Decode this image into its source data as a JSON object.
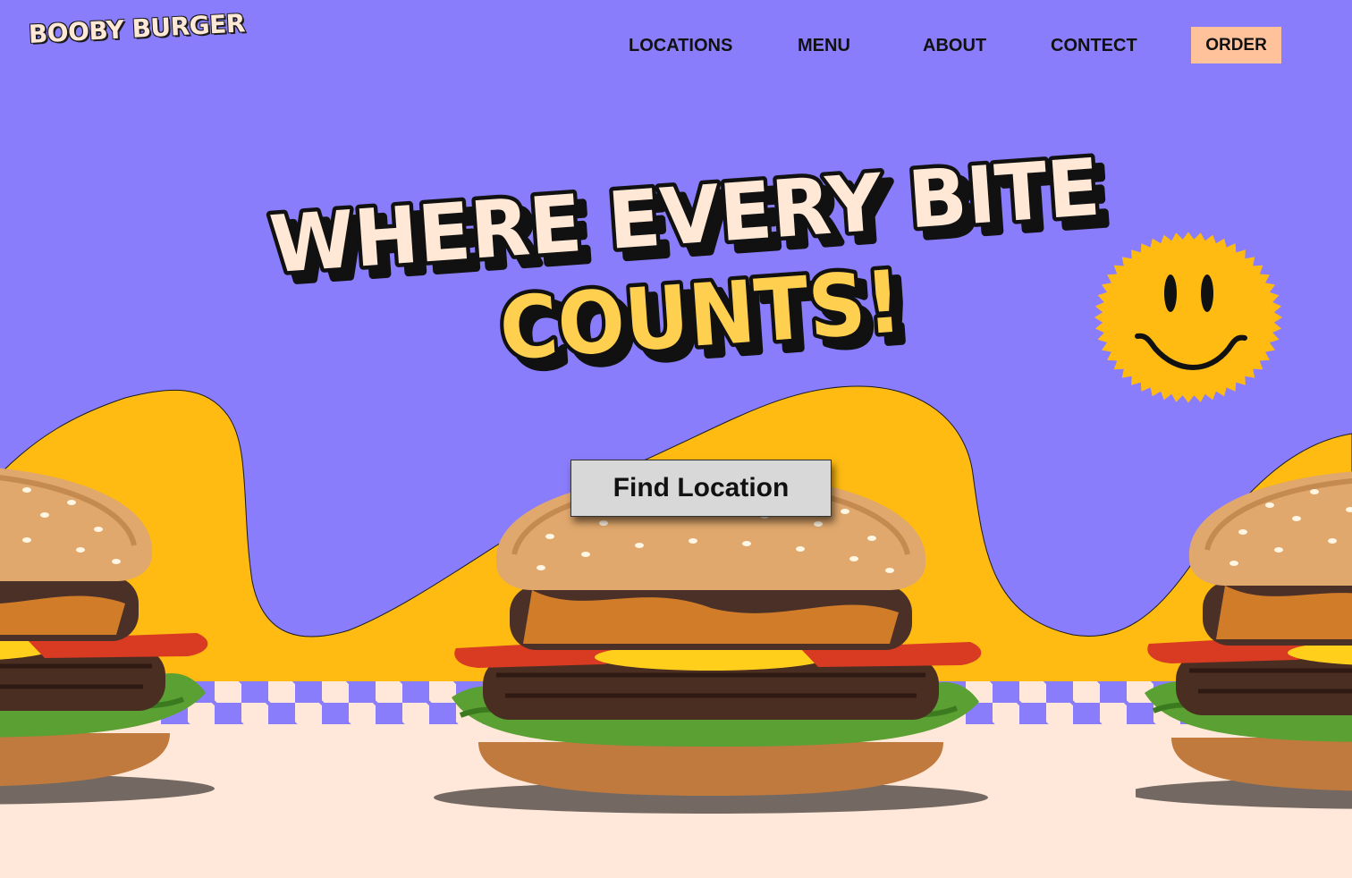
{
  "brand": {
    "logo": "BOOBY BURGER"
  },
  "nav": {
    "items": [
      "LOCATIONS",
      "MENU",
      "ABOUT",
      "CONTECT"
    ],
    "order_label": "ORDER"
  },
  "hero": {
    "headline_line1": "WHERE EVERY BITE",
    "headline_line2": "COUNTS!",
    "cta_label": "Find Location"
  },
  "colors": {
    "background": "#8a7dfc",
    "accent_yellow": "#ffbb12",
    "cream": "#ffe8d9",
    "order_button": "#ffc29a",
    "headline_cream": "#ffe8d6",
    "headline_yellow": "#ffcf4f"
  },
  "icons": {
    "smiley": "smiley-sun-icon",
    "burger": "burger-image"
  }
}
